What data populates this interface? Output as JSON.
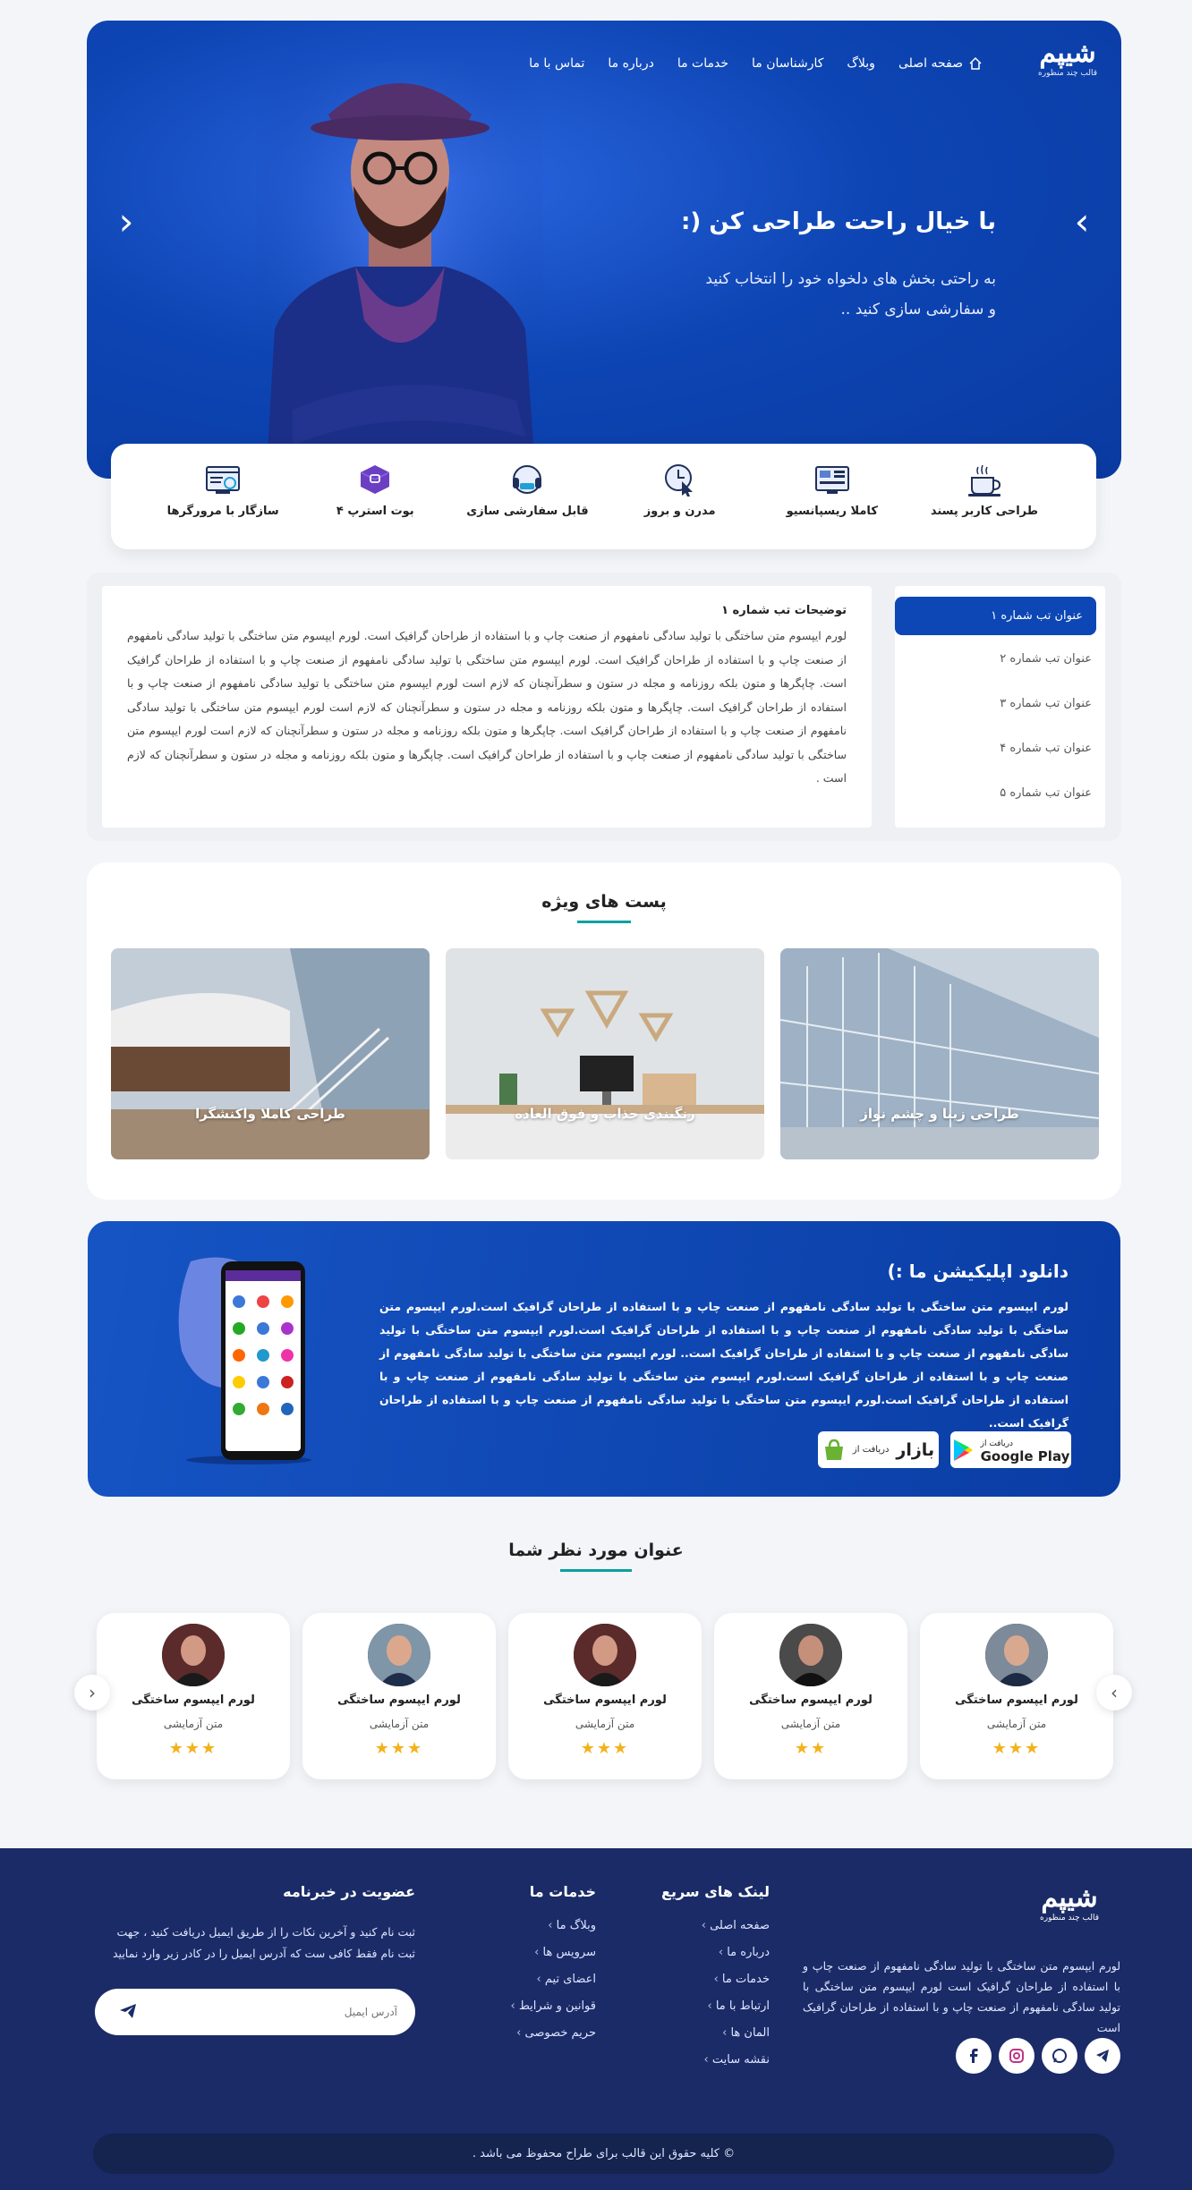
{
  "brand": {
    "logo_text": "شیپم",
    "logo_sub": "قالب چند منظوره"
  },
  "nav": {
    "home": "صفحه اصلی",
    "blog": "وبلاگ",
    "experts": "کارشناسان ما",
    "services": "خدمات ما",
    "about": "درباره ما",
    "contact": "تماس با ما"
  },
  "hero": {
    "title": "با خیال راحت طراحی کن (:",
    "subtitle_line1": "به راحتی بخش های دلخواه خود را انتخاب کنید",
    "subtitle_line2": "و سفارشی سازی کنید .."
  },
  "features": [
    "طراحی کاربر پسند",
    "کاملا ریسپانسیو",
    "مدرن و بروز",
    "قابل سفارشی سازی",
    "بوت استرپ ۴",
    "سازگار با مرورگرها"
  ],
  "tabs": {
    "items": [
      "عنوان تب شماره ۱",
      "عنوان تب شماره ۲",
      "عنوان تب شماره ۳",
      "عنوان تب شماره ۴",
      "عنوان تب شماره ۵"
    ],
    "content_title": "توضیحات تب شماره ۱",
    "content_text": "لورم ایپسوم متن ساختگی با تولید سادگی نامفهوم از صنعت چاپ و با استفاده از طراحان گرافیک است. لورم ایپسوم متن ساختگی با تولید سادگی نامفهوم از صنعت چاپ و با استفاده از طراحان گرافیک است. لورم ایپسوم متن ساختگی با تولید سادگی نامفهوم از صنعت چاپ و با استفاده از طراحان گرافیک است. چاپگرها و متون بلکه روزنامه و مجله در ستون و سطرآنچنان که لازم است لورم ایپسوم متن ساختگی با تولید سادگی نامفهوم از صنعت چاپ و با استفاده از طراحان گرافیک است. چاپگرها و متون بلکه روزنامه و مجله در ستون و سطرآنچنان که لازم است لورم ایپسوم متن ساختگی با تولید سادگی نامفهوم از صنعت چاپ و با استفاده از طراحان گرافیک است. چاپگرها و متون بلکه روزنامه و مجله در ستون و سطرآنچنان که لازم است لورم ایپسوم متن ساختگی با تولید سادگی نامفهوم از صنعت چاپ و با استفاده از طراحان گرافیک است. چاپگرها و متون بلکه روزنامه و مجله در ستون و سطرآنچنان که لازم است ."
  },
  "posts": {
    "title": "پست های ویژه",
    "items": [
      "طراحی زیبا و چشم نواز",
      "رنگبندی جذاب و فوق العاده",
      "طراحی کاملا واکنشگرا"
    ]
  },
  "app": {
    "title": "دانلود اپلیکیشن ما :)",
    "text": "لورم ایپسوم متن ساختگی با تولید سادگی نامفهوم از صنعت چاپ و با استفاده از طراحان گرافیک است.لورم ایپسوم متن ساختگی با تولید سادگی نامفهوم از صنعت چاپ و با استفاده از طراحان گرافیک است.لورم ایپسوم متن ساختگی با تولید سادگی نامفهوم از صنعت چاپ و با استفاده از طراحان گرافیک است.. لورم ایپسوم متن ساختگی با تولید سادگی نامفهوم از صنعت چاپ و با استفاده از طراحان گرافیک است.لورم ایپسوم متن ساختگی با تولید سادگی نامفهوم از صنعت چاپ و با استفاده از طراحان گرافیک است.لورم ایپسوم متن ساختگی با تولید سادگی نامفهوم از صنعت چاپ و با استفاده از طراحان گرافیک است..",
    "gplay_small": "دریافت از",
    "gplay_big": "Google Play",
    "bazaar_small": "دریافت از",
    "bazaar_big": "بازار"
  },
  "testimonials": {
    "title": "عنوان مورد نظر شما",
    "items": [
      {
        "name": "لورم ایپسوم ساختگی",
        "role": "متن آزمایشی",
        "stars": "★★★"
      },
      {
        "name": "لورم ایپسوم ساختگی",
        "role": "متن آزمایشی",
        "stars": "★★"
      },
      {
        "name": "لورم ایپسوم ساختگی",
        "role": "متن آزمایشی",
        "stars": "★★★"
      },
      {
        "name": "لورم ایپسوم ساختگی",
        "role": "متن آزمایشی",
        "stars": "★★★"
      },
      {
        "name": "لورم ایپسوم ساختگی",
        "role": "متن آزمایشی",
        "stars": "★★★"
      }
    ]
  },
  "footer": {
    "about": "لورم ایپسوم متن ساختگی با تولید سادگی نامفهوم از صنعت چاپ و با استفاده از طراحان گرافیک است لورم ایپسوم متن ساختگی با تولید سادگی نامفهوم از صنعت چاپ و با استفاده از طراحان گرافیک است",
    "quick_title": "لینک های سریع",
    "quick": [
      "صفحه اصلی",
      "درباره ما",
      "خدمات ما",
      "ارتباط با ما",
      "المان ها",
      "نقشه سایت"
    ],
    "services_title": "خدمات ما",
    "services": [
      "وبلاگ ما",
      "سرویس ها",
      "اعضای تیم",
      "قوانین و شرایط",
      "حریم خصوصی"
    ],
    "news_title": "عضویت در خبرنامه",
    "news_text": "ثبت نام کنید و آخرین نکات را از طریق ایمیل دریافت کنید ، جهت ثبت نام فقط کافی ست که آدرس ایمیل را در کادر زیر وارد نمایید",
    "email_placeholder": "آدرس ایمیل",
    "copyright": "© کلیه حقوق این قالب برای طراح محفوظ می باشد ."
  },
  "colors": {
    "primary": "#0d47b6",
    "footer": "#1a2b67",
    "accent": "#0aa0a0",
    "star": "#f3b21b"
  }
}
